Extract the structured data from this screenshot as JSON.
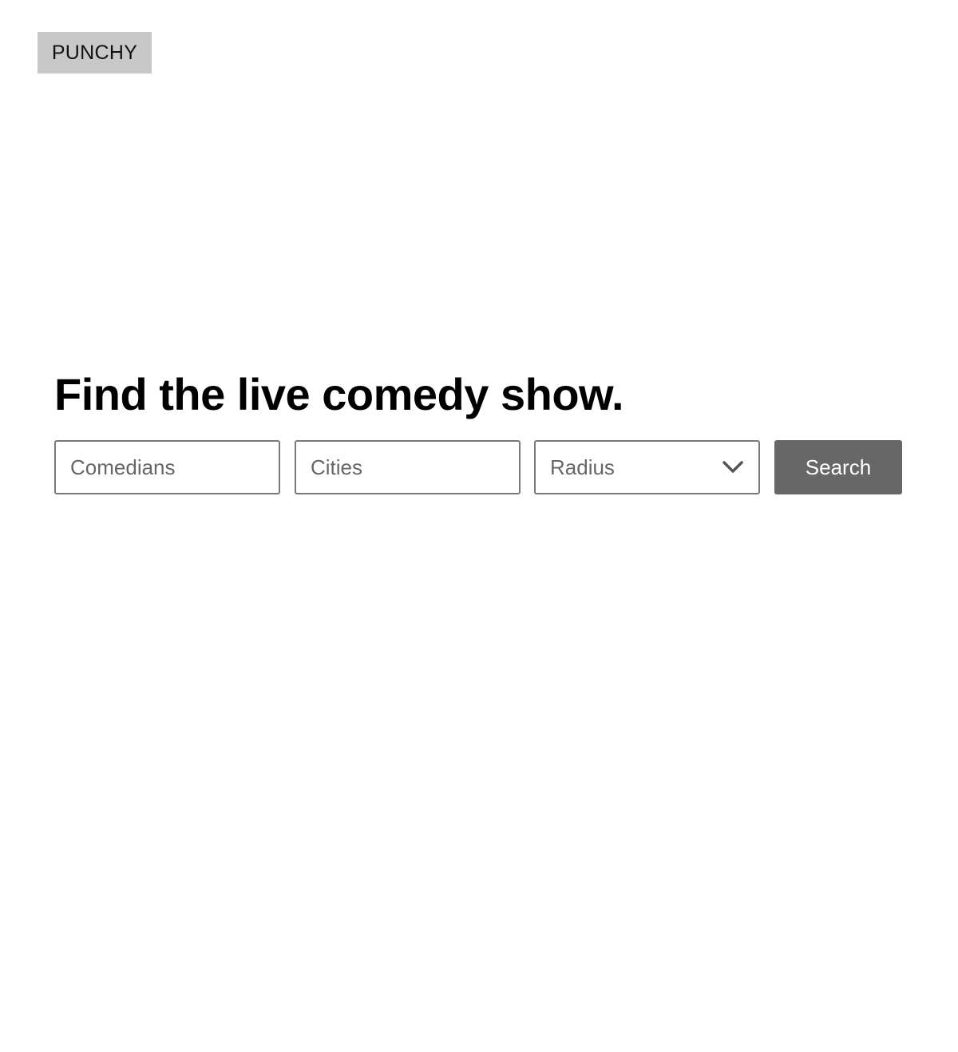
{
  "header": {
    "logo_text": "PUNCHY"
  },
  "hero": {
    "title": "Find the live comedy show."
  },
  "search": {
    "comedians_placeholder": "Comedians",
    "cities_placeholder": "Cities",
    "radius_label": "Radius",
    "radius_icon": "chevron-down-icon",
    "button_label": "Search"
  },
  "colors": {
    "logo_background": "#c8c8c8",
    "button_background": "#676767",
    "field_border": "#7a7a7a",
    "placeholder_text": "#666666"
  }
}
